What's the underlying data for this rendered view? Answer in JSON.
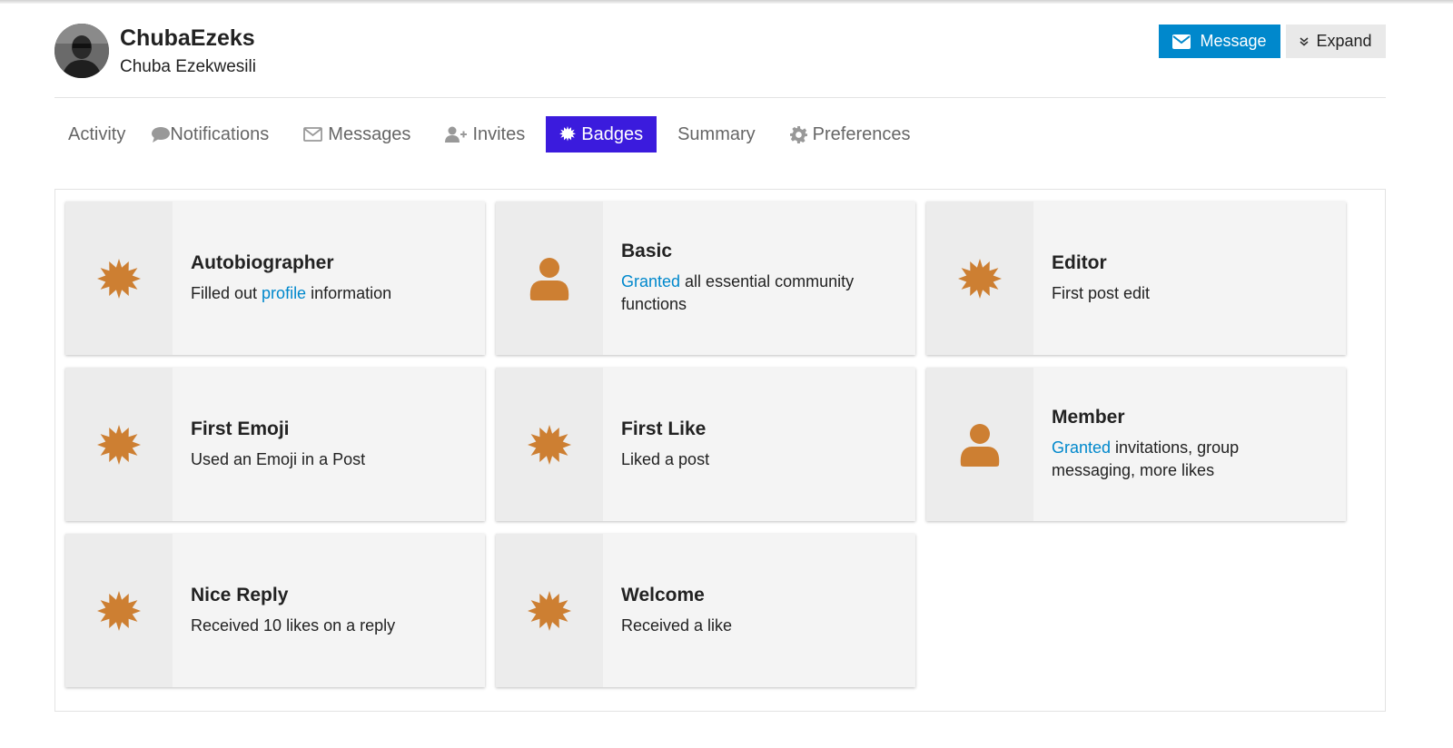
{
  "user": {
    "username": "ChubaEzeks",
    "full_name": "Chuba Ezekwesili"
  },
  "actions": {
    "message_label": "Message",
    "expand_label": "Expand"
  },
  "nav": {
    "tabs": [
      {
        "label": "Activity",
        "icon": "none"
      },
      {
        "label": "Notifications",
        "icon": "speech-bubble-icon"
      },
      {
        "label": "Messages",
        "icon": "envelope-icon"
      },
      {
        "label": "Invites",
        "icon": "user-plus-icon"
      },
      {
        "label": "Badges",
        "icon": "badge-icon",
        "active": true
      },
      {
        "label": "Summary",
        "icon": "none"
      },
      {
        "label": "Preferences",
        "icon": "gear-icon"
      }
    ]
  },
  "badges": [
    {
      "title": "Autobiographer",
      "icon": "badge-icon",
      "desc_before": "Filled out ",
      "desc_link": "profile",
      "desc_after": " information"
    },
    {
      "title": "Basic",
      "icon": "user-icon",
      "desc_before": "",
      "desc_link": "Granted",
      "desc_after": " all essential community functions"
    },
    {
      "title": "Editor",
      "icon": "badge-icon",
      "desc_before": "First post edit",
      "desc_link": "",
      "desc_after": ""
    },
    {
      "title": "First Emoji",
      "icon": "badge-icon",
      "desc_before": "Used an Emoji in a Post",
      "desc_link": "",
      "desc_after": ""
    },
    {
      "title": "First Like",
      "icon": "badge-icon",
      "desc_before": "Liked a post",
      "desc_link": "",
      "desc_after": ""
    },
    {
      "title": "Member",
      "icon": "user-icon",
      "desc_before": "",
      "desc_link": "Granted",
      "desc_after": " invitations, group messaging, more likes"
    },
    {
      "title": "Nice Reply",
      "icon": "badge-icon",
      "desc_before": "Received 10 likes on a reply",
      "desc_link": "",
      "desc_after": ""
    },
    {
      "title": "Welcome",
      "icon": "badge-icon",
      "desc_before": "Received a like",
      "desc_link": "",
      "desc_after": ""
    }
  ],
  "colors": {
    "accent": "#0088cc",
    "active_tab": "#3b1bdd",
    "badge_bronze": "#cd7f32"
  }
}
